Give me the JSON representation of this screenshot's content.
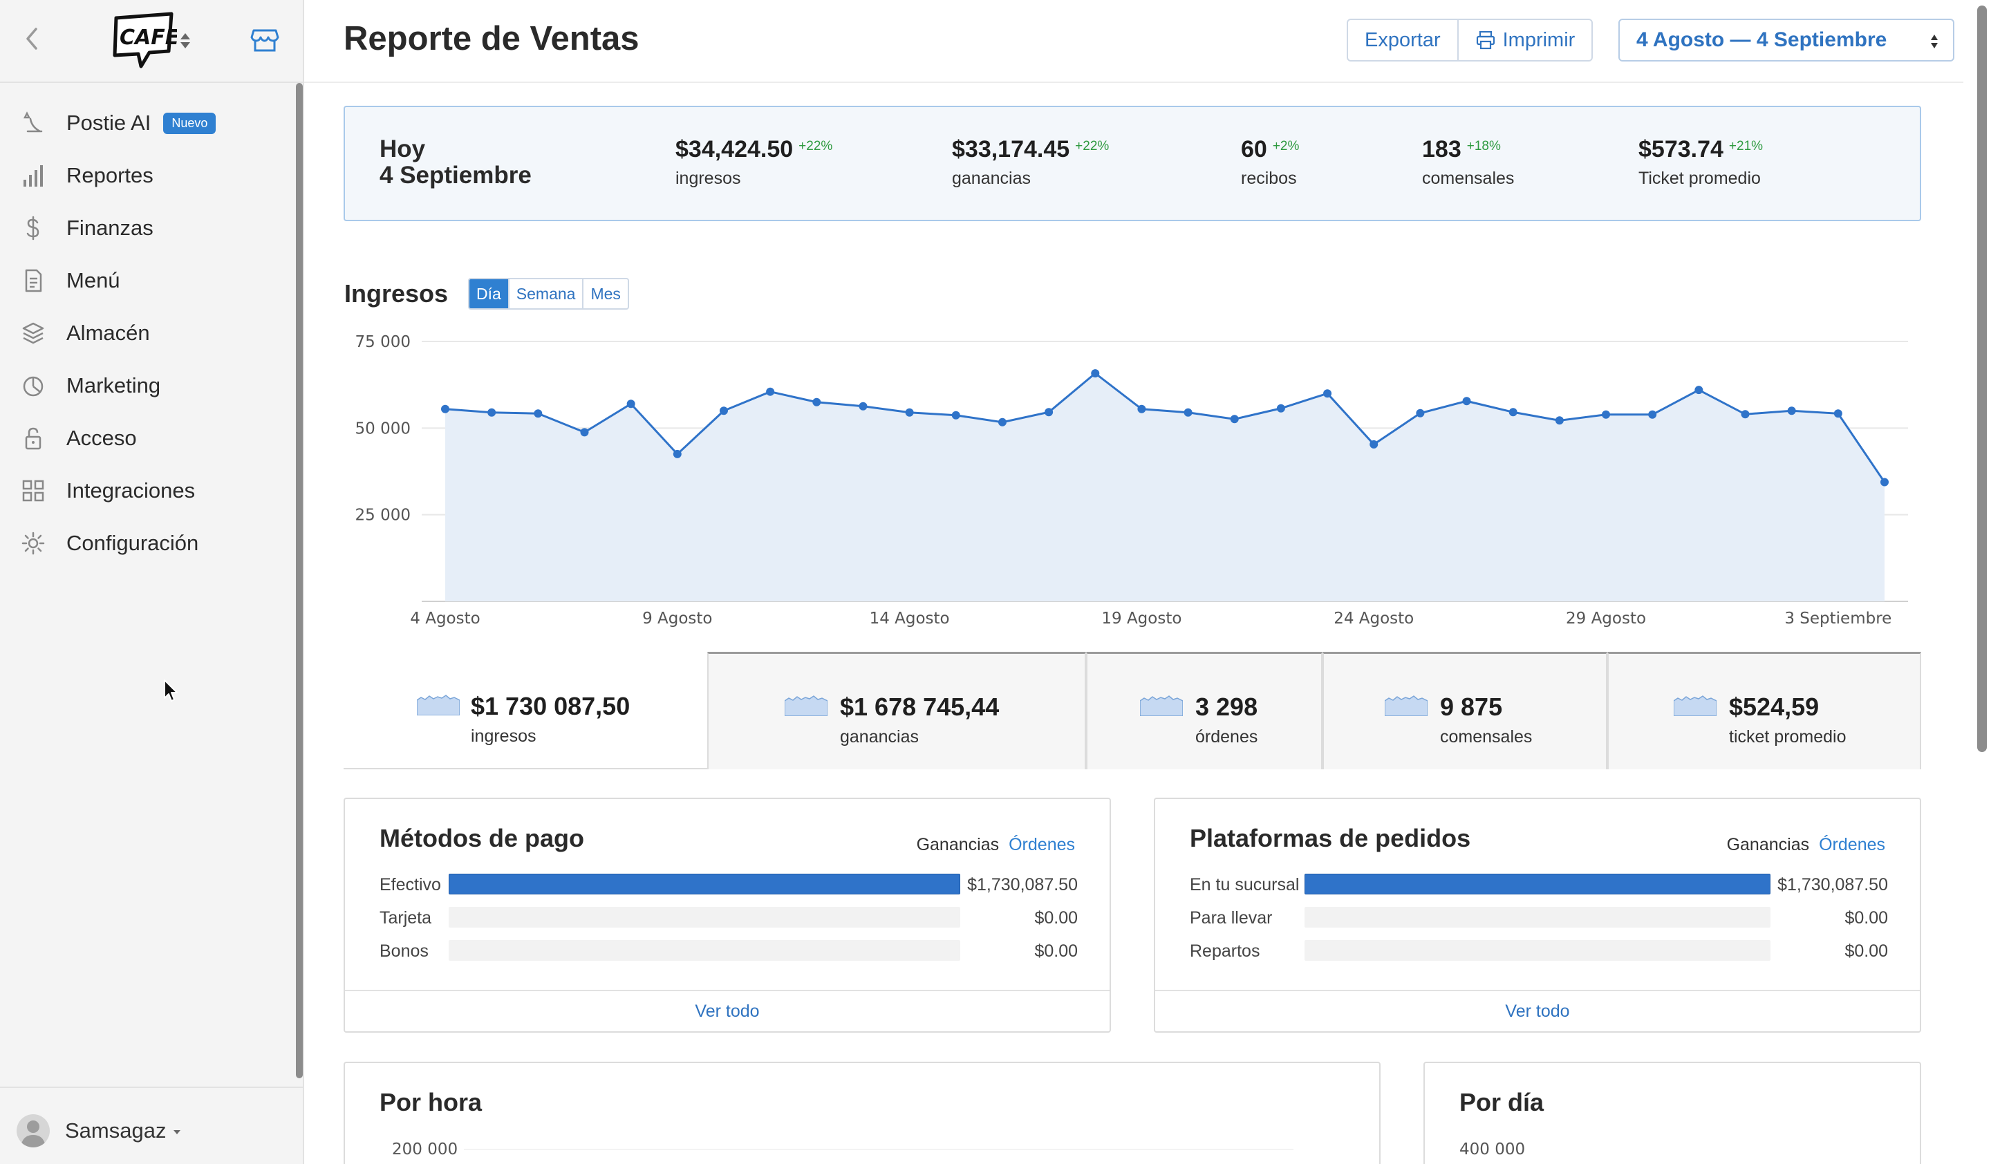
{
  "sidebar": {
    "items": [
      {
        "label": "Postie AI",
        "icon": "ai-sparkle-icon",
        "badge": "Nuevo"
      },
      {
        "label": "Reportes",
        "icon": "bar-chart-icon"
      },
      {
        "label": "Finanzas",
        "icon": "dollar-icon"
      },
      {
        "label": "Menú",
        "icon": "document-icon"
      },
      {
        "label": "Almacén",
        "icon": "layers-icon"
      },
      {
        "label": "Marketing",
        "icon": "pie-icon"
      },
      {
        "label": "Acceso",
        "icon": "lock-icon"
      },
      {
        "label": "Integraciones",
        "icon": "grid-icon"
      },
      {
        "label": "Configuración",
        "icon": "gear-icon"
      }
    ],
    "user": "Samsagaz"
  },
  "header": {
    "title": "Reporte de Ventas",
    "export_label": "Exportar",
    "print_label": "Imprimir",
    "date_range": "4 Agosto — 4 Septiembre"
  },
  "today": {
    "label_line1": "Hoy",
    "label_line2": "4 Septiembre",
    "kpis": [
      {
        "value": "$34,424.50",
        "delta": "+22%",
        "label": "ingresos"
      },
      {
        "value": "$33,174.45",
        "delta": "+22%",
        "label": "ganancias"
      },
      {
        "value": "60",
        "delta": "+2%",
        "label": "recibos"
      },
      {
        "value": "183",
        "delta": "+18%",
        "label": "comensales"
      },
      {
        "value": "$573.74",
        "delta": "+21%",
        "label": "Ticket promedio"
      }
    ]
  },
  "income": {
    "title": "Ingresos",
    "segments": [
      "Día",
      "Semana",
      "Mes"
    ],
    "active_segment": "Día"
  },
  "chart_data": {
    "type": "area",
    "x": [
      "4 Agosto",
      "5 Agosto",
      "6 Agosto",
      "7 Agosto",
      "8 Agosto",
      "9 Agosto",
      "10 Agosto",
      "11 Agosto",
      "12 Agosto",
      "13 Agosto",
      "14 Agosto",
      "15 Agosto",
      "16 Agosto",
      "17 Agosto",
      "18 Agosto",
      "19 Agosto",
      "20 Agosto",
      "21 Agosto",
      "22 Agosto",
      "23 Agosto",
      "24 Agosto",
      "25 Agosto",
      "26 Agosto",
      "27 Agosto",
      "28 Agosto",
      "29 Agosto",
      "30 Agosto",
      "31 Agosto",
      "1 Septiembre",
      "2 Septiembre",
      "3 Septiembre",
      "4 Septiembre"
    ],
    "values": [
      55500,
      54500,
      54200,
      48800,
      57000,
      42500,
      55000,
      60500,
      57500,
      56300,
      54500,
      53700,
      51700,
      54600,
      65800,
      55500,
      54500,
      52600,
      55700,
      60000,
      45300,
      54300,
      57800,
      54600,
      52200,
      53900,
      53900,
      61000,
      54000,
      55000,
      54200,
      34400
    ],
    "x_ticks": [
      "4 Agosto",
      "9 Agosto",
      "14 Agosto",
      "19 Agosto",
      "24 Agosto",
      "29 Agosto",
      "3 Septiembre"
    ],
    "y_ticks": [
      "25 000",
      "50 000",
      "75 000"
    ],
    "ylim": [
      0,
      75000
    ],
    "grid": true,
    "colors": {
      "line": "#2f73c9",
      "fill": "#e6eef8"
    }
  },
  "totals": [
    {
      "value": "$1 730 087,50",
      "label": "ingresos"
    },
    {
      "value": "$1 678 745,44",
      "label": "ganancias"
    },
    {
      "value": "3 298",
      "label": "órdenes"
    },
    {
      "value": "9 875",
      "label": "comensales"
    },
    {
      "value": "$524,59",
      "label": "ticket promedio"
    }
  ],
  "payments": {
    "title": "Métodos de pago",
    "toggle_on": "Ganancias",
    "toggle_off": "Órdenes",
    "rows": [
      {
        "name": "Efectivo",
        "amount": "$1,730,087.50",
        "share": 1.0
      },
      {
        "name": "Tarjeta",
        "amount": "$0.00",
        "share": 0
      },
      {
        "name": "Bonos",
        "amount": "$0.00",
        "share": 0
      }
    ],
    "footer": "Ver todo"
  },
  "platforms": {
    "title": "Plataformas de pedidos",
    "toggle_on": "Ganancias",
    "toggle_off": "Órdenes",
    "rows": [
      {
        "name": "En tu sucursal",
        "amount": "$1,730,087.50",
        "share": 1.0
      },
      {
        "name": "Para llevar",
        "amount": "$0.00",
        "share": 0
      },
      {
        "name": "Repartos",
        "amount": "$0.00",
        "share": 0
      }
    ],
    "footer": "Ver todo"
  },
  "by_hour": {
    "title": "Por hora",
    "y_top": "200 000"
  },
  "by_day": {
    "title": "Por día",
    "y_top": "400 000"
  }
}
